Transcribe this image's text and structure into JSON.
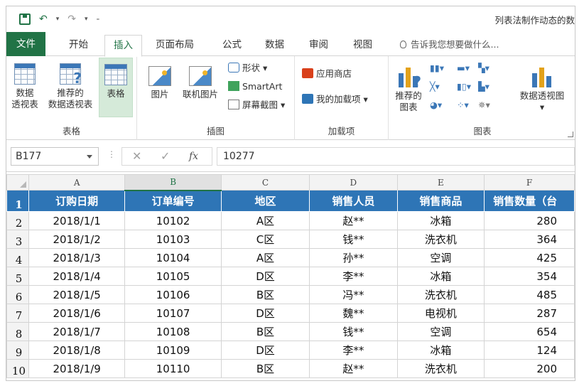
{
  "title_bar": {
    "document_title": "列表法制作动态的数"
  },
  "tabs": [
    {
      "label": "文件"
    },
    {
      "label": "开始"
    },
    {
      "label": "插入"
    },
    {
      "label": "页面布局"
    },
    {
      "label": "公式"
    },
    {
      "label": "数据"
    },
    {
      "label": "审阅"
    },
    {
      "label": "视图"
    }
  ],
  "tell_me": "告诉我您想要做什么...",
  "ribbon": {
    "tables": {
      "label": "表格",
      "pivot_line1": "数据",
      "pivot_line2": "透视表",
      "recommended_line1": "推荐的",
      "recommended_line2": "数据透视表",
      "table": "表格"
    },
    "illustrations": {
      "label": "插图",
      "pictures": "图片",
      "online_pictures": "联机图片",
      "shapes": "形状",
      "smartart": "SmartArt",
      "screenshot": "屏幕截图"
    },
    "addins": {
      "label": "加载项",
      "store": "应用商店",
      "my_addins": "我的加载项"
    },
    "charts": {
      "label": "图表",
      "recommended_line1": "推荐的",
      "recommended_line2": "图表",
      "pivot_chart": "数据透视图"
    }
  },
  "formula_bar": {
    "name_box": "B177",
    "fx": "fx",
    "value": "10277"
  },
  "sheet": {
    "columns": [
      "A",
      "B",
      "C",
      "D",
      "E",
      "F"
    ],
    "rows": [
      "1",
      "2",
      "3",
      "4",
      "5",
      "6",
      "7",
      "8",
      "9",
      "10"
    ],
    "header": [
      "订购日期",
      "订单编号",
      "地区",
      "销售人员",
      "销售商品",
      "销售数量（台"
    ],
    "data": [
      [
        "2018/1/1",
        "10102",
        "A区",
        "赵**",
        "冰箱",
        "280"
      ],
      [
        "2018/1/2",
        "10103",
        "C区",
        "钱**",
        "洗衣机",
        "364"
      ],
      [
        "2018/1/3",
        "10104",
        "A区",
        "孙**",
        "空调",
        "425"
      ],
      [
        "2018/1/4",
        "10105",
        "D区",
        "李**",
        "冰箱",
        "354"
      ],
      [
        "2018/1/5",
        "10106",
        "B区",
        "冯**",
        "洗衣机",
        "485"
      ],
      [
        "2018/1/6",
        "10107",
        "D区",
        "魏**",
        "电视机",
        "287"
      ],
      [
        "2018/1/7",
        "10108",
        "B区",
        "钱**",
        "空调",
        "654"
      ],
      [
        "2018/1/8",
        "10109",
        "D区",
        "李**",
        "冰箱",
        "124"
      ],
      [
        "2018/1/9",
        "10110",
        "B区",
        "赵**",
        "洗衣机",
        "200"
      ]
    ]
  },
  "colors": {
    "accent": "#217346",
    "header_fill": "#2e75b6"
  }
}
